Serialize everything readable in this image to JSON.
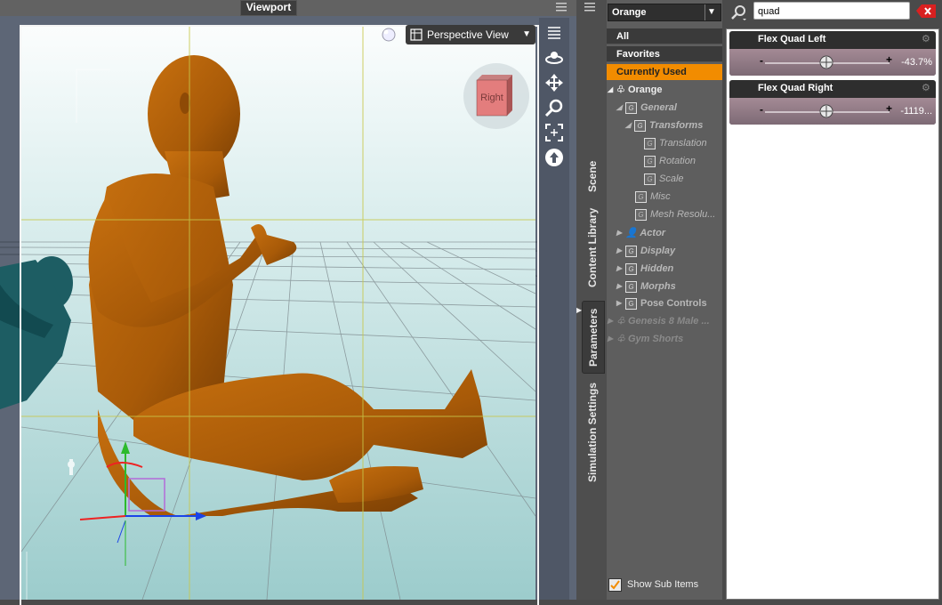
{
  "viewport": {
    "title": "Viewport",
    "view_mode": "Perspective View",
    "cube_face": "Right"
  },
  "side_tabs": [
    "Scene",
    "Content Library",
    "Parameters",
    "Simulation Settings"
  ],
  "tree": {
    "node_select": "Orange",
    "categories": [
      "All",
      "Favorites",
      "Currently Used"
    ],
    "items": [
      {
        "label": "Orange"
      },
      {
        "label": "General"
      },
      {
        "label": "Transforms"
      },
      {
        "label": "Translation"
      },
      {
        "label": "Rotation"
      },
      {
        "label": "Scale"
      },
      {
        "label": "Misc"
      },
      {
        "label": "Mesh Resolu..."
      },
      {
        "label": "Actor"
      },
      {
        "label": "Display"
      },
      {
        "label": "Hidden"
      },
      {
        "label": "Morphs"
      },
      {
        "label": "Pose Controls"
      },
      {
        "label": "Genesis 8 Male ..."
      },
      {
        "label": "Gym Shorts"
      }
    ],
    "show_sub_items": "Show Sub Items",
    "show_sub_checked": true
  },
  "search": {
    "value": "quad"
  },
  "properties": [
    {
      "name": "Flex Quad Left",
      "value": "-43.7%",
      "minus": "-",
      "plus": "+"
    },
    {
      "name": "Flex Quad Right",
      "value": "-1119...",
      "minus": "-",
      "plus": "+"
    }
  ],
  "colors": {
    "accent": "#f28c00",
    "figure": "#b8650c",
    "teal_figure": "#1b5d63"
  }
}
